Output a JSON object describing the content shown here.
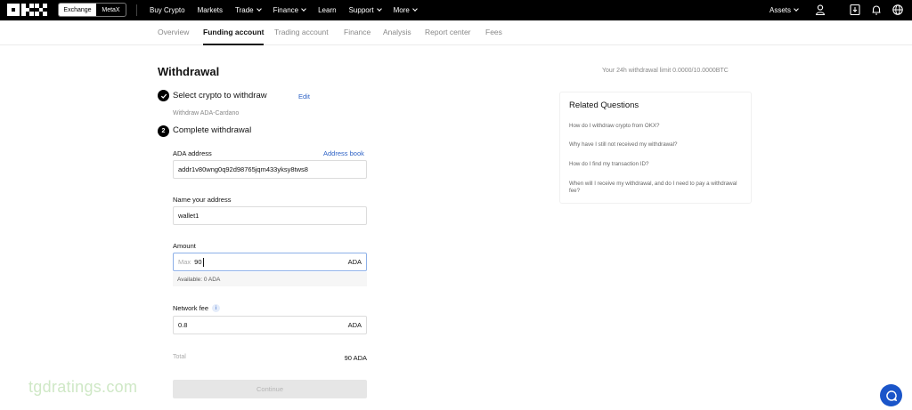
{
  "topnav": {
    "switch": {
      "exchange": "Exchange",
      "metax": "MetaX"
    },
    "items": [
      {
        "label": "Buy Crypto",
        "chevron": false
      },
      {
        "label": "Markets",
        "chevron": false
      },
      {
        "label": "Trade",
        "chevron": true
      },
      {
        "label": "Finance",
        "chevron": true
      },
      {
        "label": "Learn",
        "chevron": false
      },
      {
        "label": "Support",
        "chevron": true
      },
      {
        "label": "More",
        "chevron": true
      }
    ],
    "assets": "Assets",
    "icons": [
      "user-icon",
      "download-icon",
      "bell-icon",
      "globe-icon"
    ]
  },
  "subnav": {
    "tabs": [
      "Overview",
      "Funding account",
      "Trading account",
      "Finance",
      "Analysis",
      "Report center",
      "Fees"
    ],
    "active": "Funding account"
  },
  "page": {
    "title": "Withdrawal",
    "limit_label": "Your 24h withdrawal limit",
    "limit_value": "0.0000/10.0000BTC"
  },
  "step1": {
    "label": "Select crypto to withdraw",
    "edit": "Edit",
    "note": "Withdraw ADA-Cardano"
  },
  "step2": {
    "number": "2",
    "label": "Complete withdrawal"
  },
  "form": {
    "address_label": "ADA address",
    "address_book": "Address book",
    "address_value": "addr1v80wng0q92d98765jqm433yksy8tws8",
    "name_label": "Name your address",
    "name_value": "wallet1",
    "amount_label": "Amount",
    "amount_max": "Max",
    "amount_value": "90",
    "amount_unit": "ADA",
    "available": "Available:  0 ADA",
    "fee_label": "Network fee",
    "fee_info": "i",
    "fee_value": "0.8",
    "fee_unit": "ADA",
    "total_label": "Total",
    "total_value": "90 ADA",
    "continue": "Continue"
  },
  "related": {
    "title": "Related Questions",
    "questions": [
      "How do I withdraw crypto from OKX?",
      "Why have I still not received my withdrawal?",
      "How do I find my transaction ID?",
      "When will I receive my withdrawal, and do I need to pay a withdrawal fee?"
    ]
  },
  "watermark": "tgdratings.com",
  "colors": {
    "link": "#2d62c6",
    "nav_bg": "#000000",
    "chat": "#1a55c9"
  }
}
